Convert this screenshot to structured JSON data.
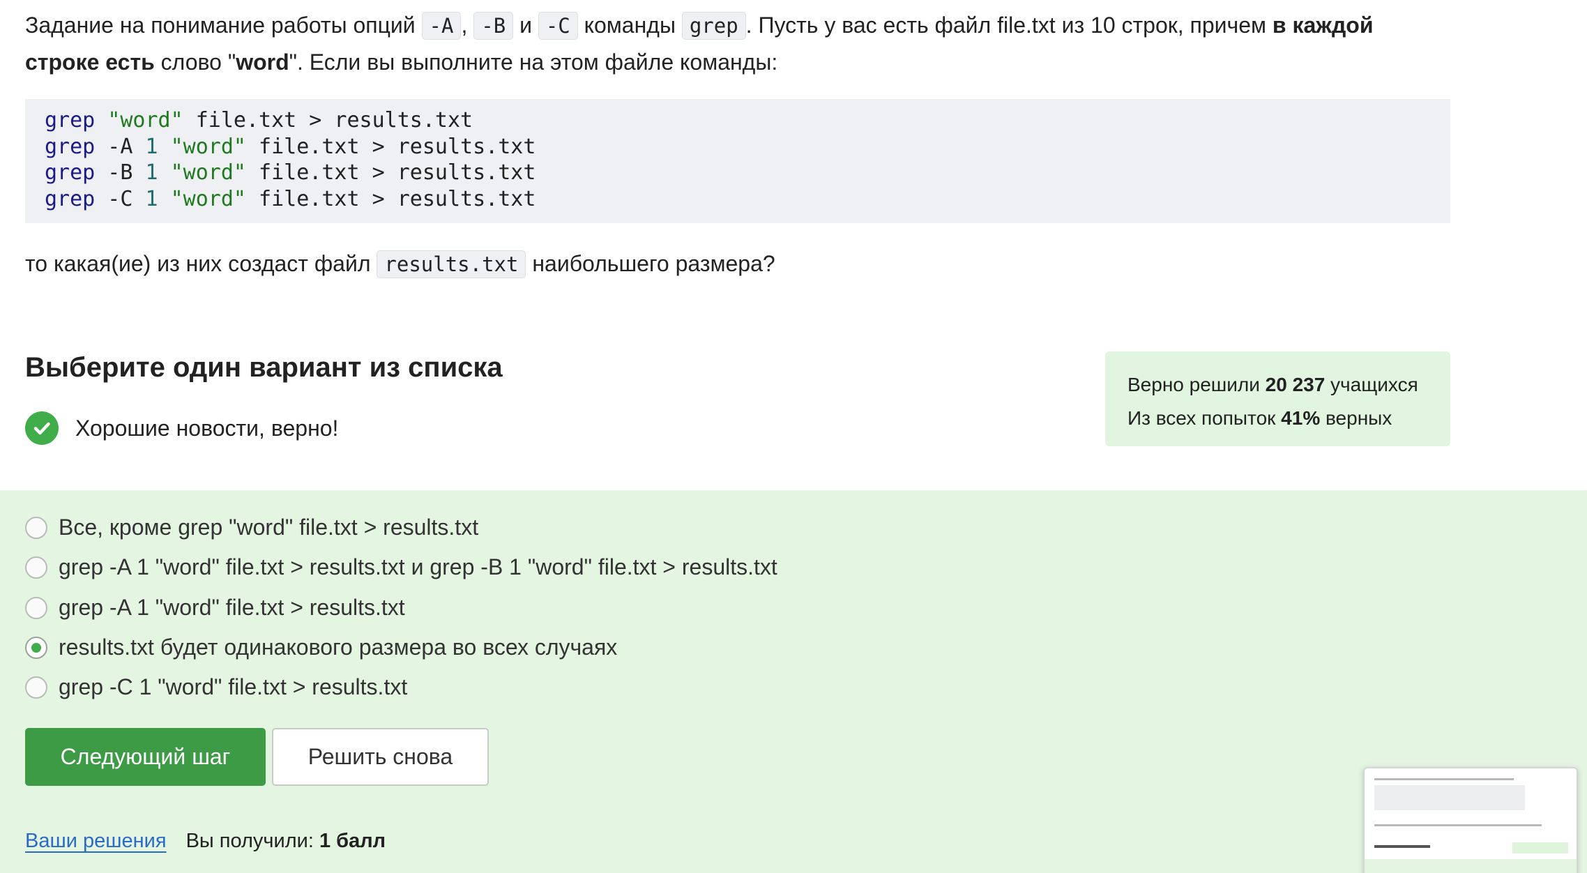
{
  "question": {
    "p1": "Задание на понимание работы опций ",
    "optA": "-A",
    "sep1": ", ",
    "optB": "-B",
    "and": " и ",
    "optC": "-C",
    "p2": " команды ",
    "cmd": "grep",
    "p3": ". Пусть у вас есть файл file.txt из 10 строк, причем ",
    "bold1": "в каждой строке есть",
    "p4": " слово \"",
    "bold2": "word",
    "p5": "\". Если вы выполните на этом файле команды:"
  },
  "code": [
    {
      "cmd": "grep",
      "flag": "",
      "num": "",
      "str": "\"word\"",
      "rest": " file.txt > results.txt"
    },
    {
      "cmd": "grep",
      "flag": " -A ",
      "num": "1",
      "str": "\"word\"",
      "rest": " file.txt > results.txt"
    },
    {
      "cmd": "grep",
      "flag": " -B ",
      "num": "1",
      "str": "\"word\"",
      "rest": " file.txt > results.txt"
    },
    {
      "cmd": "grep",
      "flag": " -C ",
      "num": "1",
      "str": "\"word\"",
      "rest": " file.txt > results.txt"
    }
  ],
  "followup": {
    "p1": "то какая(ие) из них создаст файл ",
    "file": "results.txt",
    "p2": " наибольшего размера?"
  },
  "section_title": "Выберите один вариант из списка",
  "result_message": "Хорошие новости, верно!",
  "stats": {
    "line1_prefix": "Верно решили ",
    "solved_count": "20 237",
    "line1_suffix": " учащихся",
    "line2_prefix": "Из всех попыток ",
    "percent": "41%",
    "line2_suffix": " верных"
  },
  "options": [
    {
      "label": "Все, кроме grep \"word\" file.txt > results.txt",
      "selected": false
    },
    {
      "label": "grep -A 1 \"word\" file.txt > results.txt и grep -B 1 \"word\" file.txt > results.txt",
      "selected": false
    },
    {
      "label": "grep -A 1 \"word\" file.txt > results.txt",
      "selected": false
    },
    {
      "label": "results.txt будет одинакового размера во всех случаях",
      "selected": true
    },
    {
      "label": "grep -C 1 \"word\" file.txt > results.txt",
      "selected": false
    }
  ],
  "buttons": {
    "next": "Следующий шаг",
    "retry": "Решить снова"
  },
  "footer": {
    "solutions_link": "Ваши решения",
    "score_prefix": "Вы получили: ",
    "score_value": "1 балл"
  },
  "colors": {
    "accent_green": "#3d9b45",
    "success_green": "#3ead4a",
    "panel_green": "#e4f5e2",
    "stats_green": "#e1f5e0",
    "link_blue": "#2a6bc9"
  },
  "icons": {
    "result": "check-circle-icon",
    "radio": "radio-icon"
  }
}
